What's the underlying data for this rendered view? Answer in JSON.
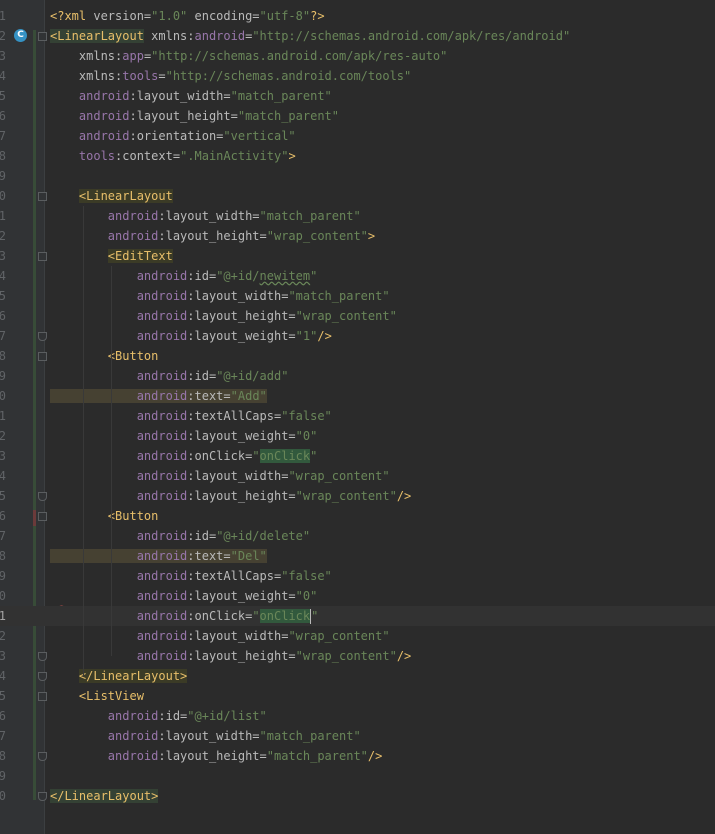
{
  "editor": {
    "file_type": "xml",
    "line_numbers": [
      "1",
      "2",
      "3",
      "4",
      "5",
      "6",
      "7",
      "8",
      "9",
      "0",
      "1",
      "2",
      "3",
      "4",
      "5",
      "6",
      "7",
      "8",
      "9",
      "0",
      "1",
      "2",
      "3",
      "4",
      "5",
      "6",
      "7",
      "8",
      "9",
      "0",
      "1",
      "2",
      "3",
      "4",
      "5",
      "6",
      "7",
      "8",
      "9",
      "0"
    ],
    "gutter_icons": {
      "class_marker": "C",
      "class_marker_icon": "class-c-icon",
      "error_icon": "error-bulb-icon"
    },
    "lines": [
      {
        "parts": [
          [
            "pi",
            "<?xml "
          ],
          [
            "attr",
            "version="
          ],
          [
            "val",
            "\"1.0\""
          ],
          [
            "attr",
            " encoding="
          ],
          [
            "val",
            "\"utf-8\""
          ],
          [
            "pi",
            "?>"
          ]
        ]
      },
      {
        "parts": [
          [
            "tag tagbg-green",
            "<LinearLayout"
          ],
          [
            "attr",
            " xmlns:"
          ],
          [
            "ns",
            "android"
          ],
          [
            "attr",
            "="
          ],
          [
            "val",
            "\"http://schemas.android.com/apk/res/android\""
          ]
        ]
      },
      {
        "parts": [
          [
            "attr",
            "    xmlns:"
          ],
          [
            "ns",
            "app"
          ],
          [
            "attr",
            "="
          ],
          [
            "val",
            "\"http://schemas.android.com/apk/res-auto\""
          ]
        ]
      },
      {
        "parts": [
          [
            "attr",
            "    xmlns:"
          ],
          [
            "ns",
            "tools"
          ],
          [
            "attr",
            "="
          ],
          [
            "val",
            "\"http://schemas.android.com/tools\""
          ]
        ]
      },
      {
        "parts": [
          [
            "ns",
            "    android"
          ],
          [
            "attr",
            ":layout_width="
          ],
          [
            "val",
            "\"match_parent\""
          ]
        ]
      },
      {
        "parts": [
          [
            "ns",
            "    android"
          ],
          [
            "attr",
            ":layout_height="
          ],
          [
            "val",
            "\"match_parent\""
          ]
        ]
      },
      {
        "parts": [
          [
            "ns",
            "    android"
          ],
          [
            "attr",
            ":orientation="
          ],
          [
            "val",
            "\"vertical\""
          ]
        ]
      },
      {
        "parts": [
          [
            "ns",
            "    tools"
          ],
          [
            "attr",
            ":context="
          ],
          [
            "val",
            "\".MainActivity\""
          ],
          [
            "tag",
            ">"
          ]
        ]
      },
      {
        "parts": []
      },
      {
        "parts": [
          [
            "attr",
            "    "
          ],
          [
            "tag tagbg",
            "<LinearLayout"
          ]
        ]
      },
      {
        "parts": [
          [
            "ns",
            "        android"
          ],
          [
            "attr",
            ":layout_width="
          ],
          [
            "val",
            "\"match_parent\""
          ]
        ]
      },
      {
        "parts": [
          [
            "ns",
            "        android"
          ],
          [
            "attr",
            ":layout_height="
          ],
          [
            "val",
            "\"wrap_content\""
          ],
          [
            "tag",
            ">"
          ]
        ]
      },
      {
        "parts": [
          [
            "attr",
            "        "
          ],
          [
            "tag tagbg",
            "<EditText"
          ]
        ]
      },
      {
        "parts": [
          [
            "ns",
            "            android"
          ],
          [
            "attr",
            ":id="
          ],
          [
            "val",
            "\"@+id/"
          ],
          [
            "val underline",
            "newitem"
          ],
          [
            "val",
            "\""
          ]
        ]
      },
      {
        "parts": [
          [
            "ns",
            "            android"
          ],
          [
            "attr",
            ":layout_width="
          ],
          [
            "val",
            "\"match_parent\""
          ]
        ]
      },
      {
        "parts": [
          [
            "ns",
            "            android"
          ],
          [
            "attr",
            ":layout_height="
          ],
          [
            "val",
            "\"wrap_content\""
          ]
        ]
      },
      {
        "parts": [
          [
            "ns",
            "            android"
          ],
          [
            "attr",
            ":layout_weight="
          ],
          [
            "val",
            "\"1\""
          ],
          [
            "tag",
            "/>"
          ]
        ]
      },
      {
        "parts": [
          [
            "attr",
            "        "
          ],
          [
            "tag",
            "<Button"
          ]
        ]
      },
      {
        "parts": [
          [
            "ns",
            "            android"
          ],
          [
            "attr",
            ":id="
          ],
          [
            "val",
            "\"@+id/add\""
          ]
        ]
      },
      {
        "parts": [
          [
            "ns attrhl",
            "            android"
          ],
          [
            "attr attrhl",
            ":text="
          ],
          [
            "val attrhl",
            "\"Add\""
          ]
        ]
      },
      {
        "parts": [
          [
            "ns",
            "            android"
          ],
          [
            "attr",
            ":textAllCaps="
          ],
          [
            "val",
            "\"false\""
          ]
        ]
      },
      {
        "parts": [
          [
            "ns",
            "            android"
          ],
          [
            "attr",
            ":layout_weight="
          ],
          [
            "val",
            "\"0\""
          ]
        ]
      },
      {
        "parts": [
          [
            "ns",
            "            android"
          ],
          [
            "attr",
            ":onClick="
          ],
          [
            "val",
            "\""
          ],
          [
            "val strhl",
            "onClick"
          ],
          [
            "val",
            "\""
          ]
        ]
      },
      {
        "parts": [
          [
            "ns",
            "            android"
          ],
          [
            "attr",
            ":layout_width="
          ],
          [
            "val",
            "\"wrap_content\""
          ]
        ]
      },
      {
        "parts": [
          [
            "ns",
            "            android"
          ],
          [
            "attr",
            ":layout_height="
          ],
          [
            "val",
            "\"wrap_content\""
          ],
          [
            "tag",
            "/>"
          ]
        ]
      },
      {
        "parts": [
          [
            "attr",
            "        "
          ],
          [
            "tag",
            "<Button"
          ]
        ]
      },
      {
        "parts": [
          [
            "ns",
            "            android"
          ],
          [
            "attr",
            ":id="
          ],
          [
            "val",
            "\"@+id/delete\""
          ]
        ]
      },
      {
        "parts": [
          [
            "ns attrhl",
            "            android"
          ],
          [
            "attr attrhl",
            ":text="
          ],
          [
            "val attrhl",
            "\"Del\""
          ]
        ]
      },
      {
        "parts": [
          [
            "ns",
            "            android"
          ],
          [
            "attr",
            ":textAllCaps="
          ],
          [
            "val",
            "\"false\""
          ]
        ]
      },
      {
        "parts": [
          [
            "ns",
            "            android"
          ],
          [
            "attr",
            ":layout_weight="
          ],
          [
            "val",
            "\"0\""
          ]
        ]
      },
      {
        "parts": [
          [
            "ns",
            "            android"
          ],
          [
            "attr",
            ":onClick="
          ],
          [
            "val",
            "\""
          ],
          [
            "val strhl",
            "onClick"
          ],
          [
            "caret",
            ""
          ],
          [
            "val",
            "\""
          ]
        ],
        "current": true
      },
      {
        "parts": [
          [
            "ns",
            "            android"
          ],
          [
            "attr",
            ":layout_width="
          ],
          [
            "val",
            "\"wrap_content\""
          ]
        ]
      },
      {
        "parts": [
          [
            "ns",
            "            android"
          ],
          [
            "attr",
            ":layout_height="
          ],
          [
            "val",
            "\"wrap_content\""
          ],
          [
            "tag",
            "/>"
          ]
        ]
      },
      {
        "parts": [
          [
            "attr",
            "    "
          ],
          [
            "tag tagbg",
            "</LinearLayout>"
          ]
        ]
      },
      {
        "parts": [
          [
            "attr",
            "    "
          ],
          [
            "tag",
            "<ListView"
          ]
        ]
      },
      {
        "parts": [
          [
            "ns",
            "        android"
          ],
          [
            "attr",
            ":id="
          ],
          [
            "val",
            "\"@+id/list\""
          ]
        ]
      },
      {
        "parts": [
          [
            "ns",
            "        android"
          ],
          [
            "attr",
            ":layout_width="
          ],
          [
            "val",
            "\"match_parent\""
          ]
        ]
      },
      {
        "parts": [
          [
            "ns",
            "        android"
          ],
          [
            "attr",
            ":layout_height="
          ],
          [
            "val",
            "\"match_parent\""
          ],
          [
            "tag",
            "/>"
          ]
        ]
      },
      {
        "parts": []
      },
      {
        "parts": [
          [
            "tag tagbg-green",
            "</LinearLayout>"
          ]
        ]
      }
    ],
    "colors": {
      "background": "#2b2b2b",
      "gutter": "#313335",
      "tag": "#e8bf6a",
      "namespace": "#9876aa",
      "value": "#6a8759",
      "attribute": "#bababa"
    }
  }
}
